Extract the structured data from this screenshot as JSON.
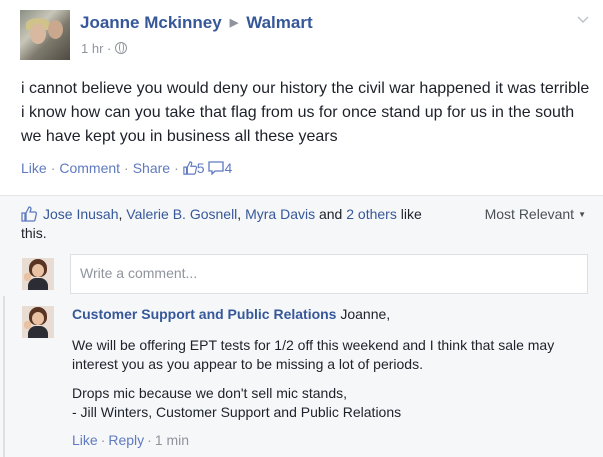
{
  "post": {
    "author": "Joanne Mckinney",
    "target": "Walmart",
    "time": "1 hr",
    "meta_sep": "·",
    "text": "i cannot believe you would deny our history the civil war happened it was terrible i know how can you take that flag from us for once stand up for us in the south we have kept you in business all these years",
    "actions": {
      "like": "Like",
      "comment": "Comment",
      "share": "Share",
      "sep": "·",
      "like_count": "5",
      "comment_count": "4"
    }
  },
  "comments_section": {
    "likers": {
      "names": [
        "Jose Inusah",
        "Valerie B. Gosnell",
        "Myra Davis"
      ],
      "sep": ", ",
      "and": " and ",
      "others": "2 others",
      "suffix": " like this."
    },
    "sort_label": "Most Relevant",
    "input_placeholder": "Write a comment...",
    "reply": {
      "author": "Customer Support and Public Relations",
      "addressee": "Joanne,",
      "paragraphs": [
        "We will be offering EPT tests for 1/2 off this weekend and I think that sale may interest you as you appear to be missing a lot of periods.",
        "Drops mic because we don't sell mic stands,",
        "- Jill Winters, Customer Support and Public Relations"
      ],
      "actions": {
        "like": "Like",
        "reply": "Reply",
        "time": "1 min",
        "sep": "·"
      }
    }
  },
  "colors": {
    "link": "#365899",
    "action": "#5f7abf",
    "meta": "#90949c",
    "text": "#1d2129",
    "comment_bg": "#f6f7f9"
  }
}
